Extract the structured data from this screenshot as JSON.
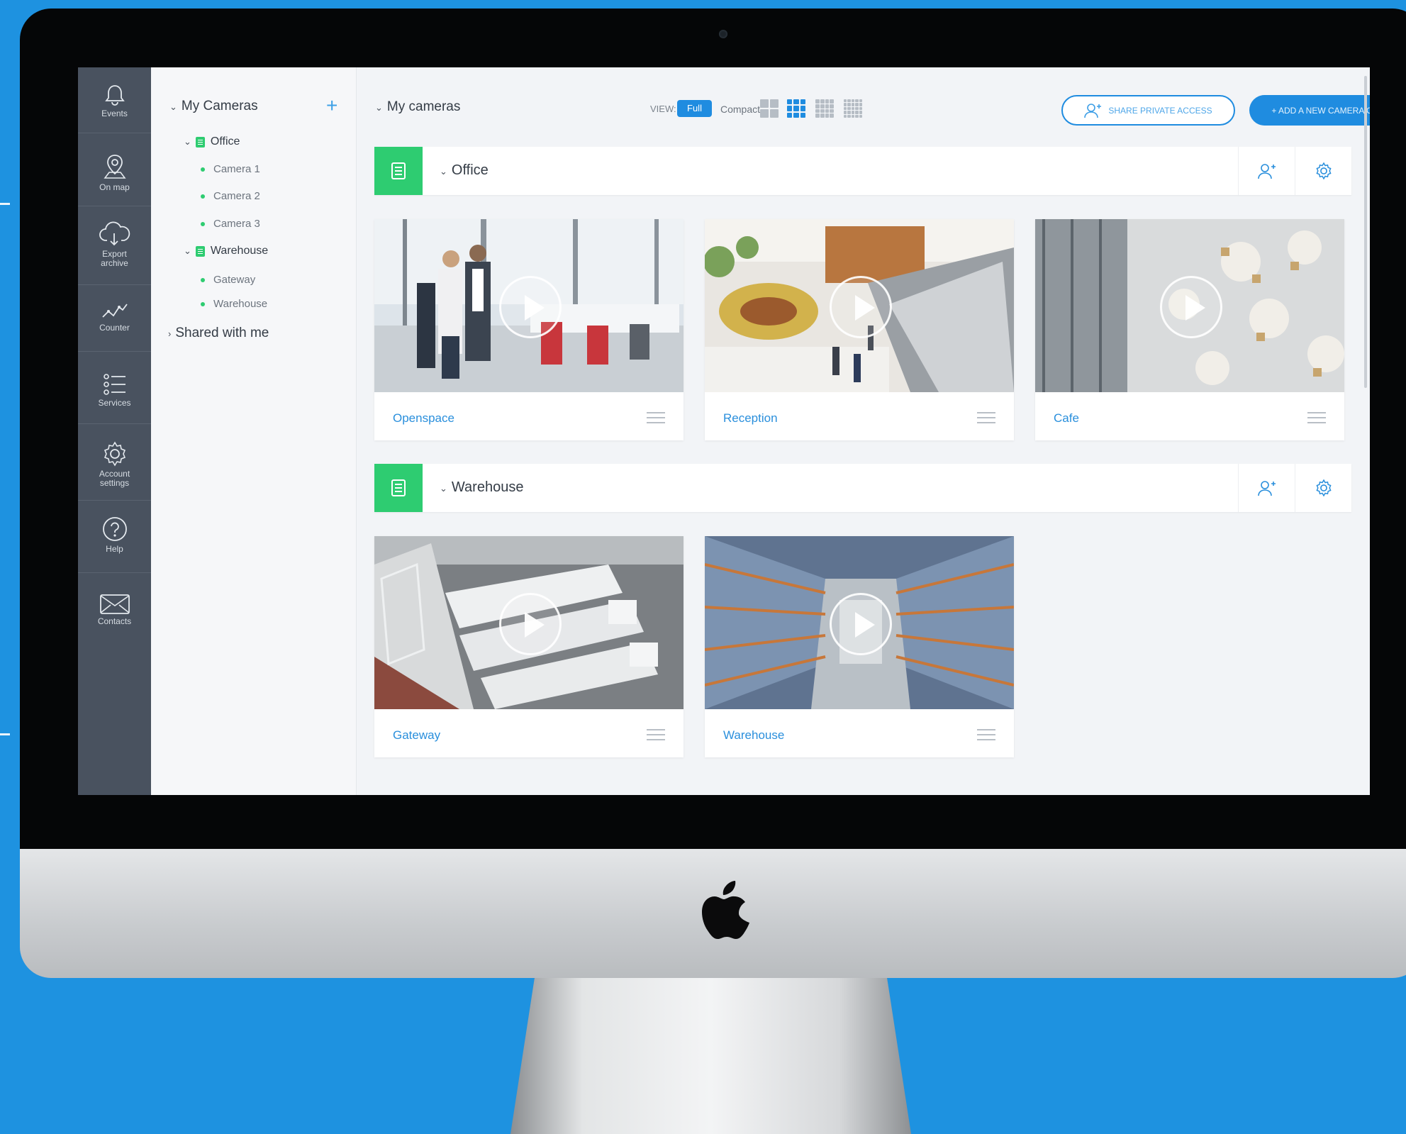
{
  "rail": {
    "items": [
      {
        "label": "Events",
        "icon": "bell-icon"
      },
      {
        "label": "On map",
        "icon": "map-pin-icon"
      },
      {
        "label": "Export archive",
        "icon": "cloud-download-icon"
      },
      {
        "label": "Counter",
        "icon": "chart-line-icon"
      },
      {
        "label": "Services",
        "icon": "list-icon"
      },
      {
        "label": "Account settings",
        "icon": "gear-icon"
      },
      {
        "label": "Help",
        "icon": "help-icon"
      },
      {
        "label": "Contacts",
        "icon": "envelope-icon"
      }
    ]
  },
  "tree": {
    "title": "My Cameras",
    "add_symbol": "+",
    "groups": [
      {
        "name": "Office",
        "cameras": [
          "Camera 1",
          "Camera 2",
          "Camera 3"
        ]
      },
      {
        "name": "Warehouse",
        "cameras": [
          "Gateway",
          "Warehouse"
        ]
      }
    ],
    "shared": "Shared with me"
  },
  "toolbar": {
    "title": "My cameras",
    "view_label": "VIEW:",
    "view_full": "Full",
    "view_compact": "Compact",
    "share_label": "SHARE PRIVATE ACCESS",
    "add_label": "+ ADD A NEW CAMERA OR DVR"
  },
  "groups": [
    {
      "title": "Office",
      "cameras": [
        "Openspace",
        "Reception",
        "Cafe"
      ]
    },
    {
      "title": "Warehouse",
      "cameras": [
        "Gateway",
        "Warehouse"
      ]
    }
  ],
  "colors": {
    "accent": "#1f8ce0",
    "group_green": "#2ecc71",
    "rail": "#49525f",
    "background": "#1e92e0"
  }
}
